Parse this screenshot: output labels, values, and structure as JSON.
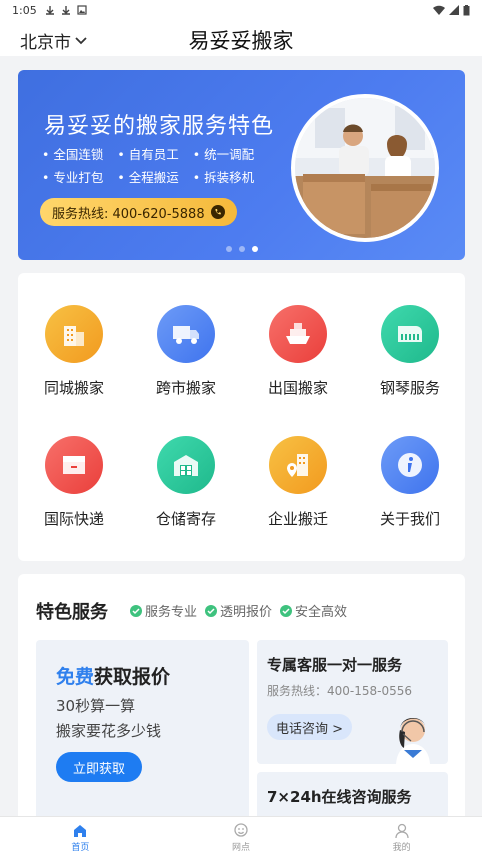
{
  "status_bar": {
    "time": "1:05"
  },
  "header": {
    "city": "北京市",
    "title": "易妥妥搬家"
  },
  "banner": {
    "title": "易妥妥的搬家服务特色",
    "features_row1": [
      "全国连锁",
      "自有员工",
      "统一调配"
    ],
    "features_row2": [
      "专业打包",
      "全程搬运",
      "拆装移机"
    ],
    "hotline": "服务热线: 400-620-5888",
    "page_count": 3,
    "active_page": 3
  },
  "grid": {
    "items": [
      {
        "label": "同城搬家",
        "icon": "building-icon",
        "color": "#f4a623"
      },
      {
        "label": "跨市搬家",
        "icon": "truck-icon",
        "color": "#4c84f3"
      },
      {
        "label": "出国搬家",
        "icon": "ship-icon",
        "color": "#f0504c"
      },
      {
        "label": "钢琴服务",
        "icon": "piano-icon",
        "color": "#2ec9a0"
      },
      {
        "label": "国际快递",
        "icon": "package-icon",
        "color": "#f0504c"
      },
      {
        "label": "仓储寄存",
        "icon": "warehouse-icon",
        "color": "#2ec9a0"
      },
      {
        "label": "企业搬迁",
        "icon": "office-location-icon",
        "color": "#f4a623"
      },
      {
        "label": "关于我们",
        "icon": "info-icon",
        "color": "#4c84f3"
      }
    ]
  },
  "features": {
    "title": "特色服务",
    "tags": [
      "服务专业",
      "透明报价",
      "安全高效"
    ],
    "quote": {
      "title_highlight": "免费",
      "title_rest": "获取报价",
      "line1": "30秒算一算",
      "line2": "搬家要花多少钱",
      "button": "立即获取"
    },
    "service": {
      "title": "专属客服一对一服务",
      "phone": "服务热线：400-158-0556",
      "button": "电话咨询 >"
    },
    "online": {
      "title": "7×24h在线咨询服务"
    }
  },
  "tabbar": {
    "tabs": [
      {
        "label": "首页",
        "active": true
      },
      {
        "label": "网点",
        "active": false
      },
      {
        "label": "我的",
        "active": false
      }
    ]
  }
}
